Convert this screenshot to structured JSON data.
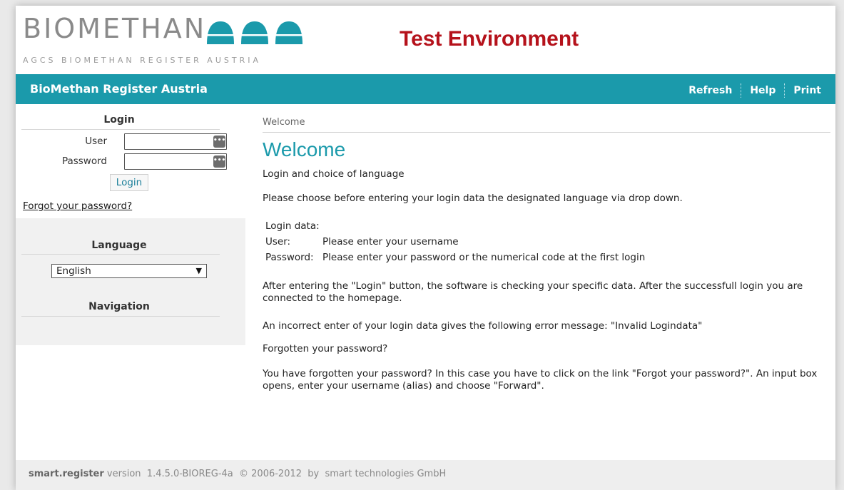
{
  "header": {
    "logo_title": "BIOMETHAN",
    "logo_subtitle": "AGCS BIOMETHAN REGISTER AUSTRIA",
    "environment": "Test Environment"
  },
  "topbar": {
    "title": "BioMethan Register Austria",
    "links": [
      "Refresh",
      "Help",
      "Print"
    ]
  },
  "sidebar": {
    "login": {
      "title": "Login",
      "user_label": "User",
      "password_label": "Password",
      "user_value": "",
      "password_value": "",
      "login_button": "Login",
      "forgot_link": "Forgot your password?"
    },
    "language": {
      "title": "Language",
      "selected": "English"
    },
    "navigation": {
      "title": "Navigation"
    }
  },
  "content": {
    "breadcrumb": "Welcome",
    "title": "Welcome",
    "subtitle": "Login and choice of language",
    "intro": "Please choose before entering your login data the designated language via drop down.",
    "login_data_label": "Login data:",
    "user_label": "User:",
    "user_text": "Please enter your username",
    "password_label": "Password:",
    "password_text": "Please enter your password or the numerical code at the first login",
    "para_after_login": "After entering the \"Login\" button, the software is checking your specific data. After the successfull login you are connected to the homepage.",
    "para_error": "An incorrect enter of your login data gives the following error message: \"Invalid Logindata\"",
    "forgot_heading": "Forgotten your password?",
    "para_forgot": "You have forgotten your password? In this case you have to click on the link \"Forgot your password?\". An input box opens, enter your username (alias) and choose \"Forward\"."
  },
  "footer": {
    "brand": "smart.register",
    "text": " version  1.4.5.0-BIOREG-4a  © 2006-2012  by  smart technologies GmbH"
  },
  "colors": {
    "accent": "#1b9aab",
    "test_red": "#b5121b"
  },
  "icons": {
    "password_manager": "dots-icon",
    "dropdown": "triangle-down-icon",
    "logo": "domes-icon"
  }
}
